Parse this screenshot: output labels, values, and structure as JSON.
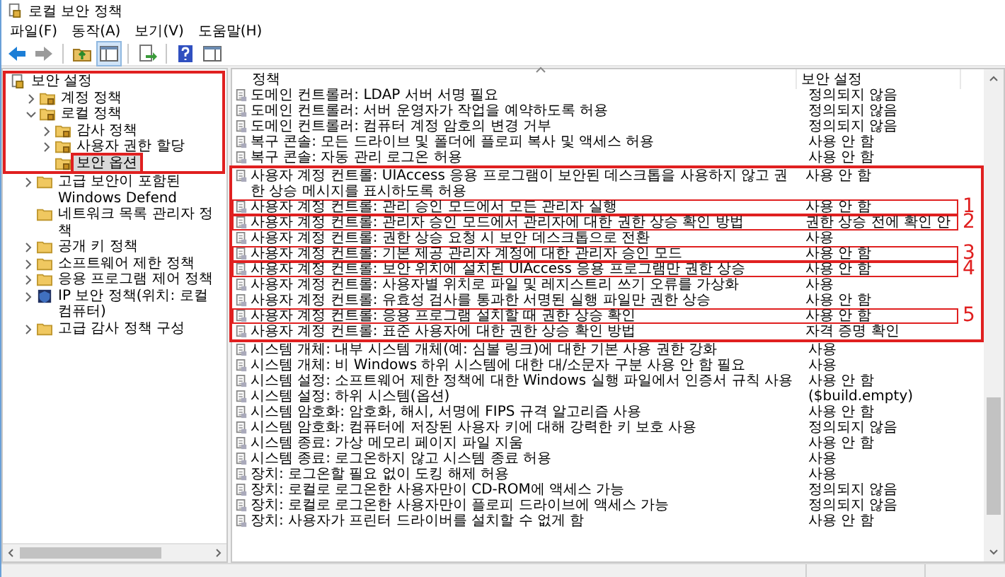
{
  "window": {
    "title": "로컬 보안 정책"
  },
  "menu": [
    "파일(F)",
    "동작(A)",
    "보기(V)",
    "도움말(H)"
  ],
  "toolbar": [
    {
      "kind": "back",
      "disabled": false
    },
    {
      "kind": "forward",
      "disabled": true
    },
    {
      "kind": "sep"
    },
    {
      "kind": "up"
    },
    {
      "kind": "tree",
      "selected": true
    },
    {
      "kind": "sep"
    },
    {
      "kind": "export"
    },
    {
      "kind": "sep"
    },
    {
      "kind": "help"
    },
    {
      "kind": "panel"
    }
  ],
  "tree": [
    {
      "label": "보안 설정",
      "kind": "root",
      "selected": false,
      "boxed": true,
      "children": [
        {
          "label": "계정 정책",
          "kind": "locked-folder",
          "expanded": false,
          "selected": false,
          "boxed": true
        },
        {
          "label": "로컬 정책",
          "kind": "locked-folder",
          "expanded": true,
          "selected": false,
          "boxed": true,
          "children": [
            {
              "label": "감사 정책",
              "kind": "locked-folder",
              "expanded": false,
              "selected": false,
              "boxed": true
            },
            {
              "label": "사용자 권한 할당",
              "kind": "locked-folder",
              "expanded": false,
              "selected": false,
              "boxed": true
            },
            {
              "label": "보안 옵션",
              "kind": "locked-folder",
              "selected": true,
              "boxed": true
            }
          ]
        },
        {
          "label": "고급 보안이 포함된 Windows Defend",
          "kind": "folder",
          "expanded": false,
          "selected": false,
          "boxed": false
        },
        {
          "label": "네트워크 목록 관리자 정책",
          "kind": "folder",
          "selected": false,
          "boxed": false
        },
        {
          "label": "공개 키 정책",
          "kind": "folder",
          "expanded": false,
          "selected": false,
          "boxed": false
        },
        {
          "label": "소프트웨어 제한 정책",
          "kind": "folder",
          "expanded": false,
          "selected": false,
          "boxed": false
        },
        {
          "label": "응용 프로그램 제어 정책",
          "kind": "folder",
          "expanded": false,
          "selected": false,
          "boxed": false
        },
        {
          "label": "IP 보안 정책(위치: 로컬 컴퓨터)",
          "kind": "ip",
          "expanded": false,
          "selected": false,
          "boxed": false
        },
        {
          "label": "고급 감사 정책 구성",
          "kind": "folder",
          "expanded": false,
          "selected": false,
          "boxed": false
        }
      ]
    }
  ],
  "table": {
    "columns": [
      "정책",
      "보안 설정"
    ],
    "rows": [
      {
        "policy": "도메인 컨트롤러: LDAP 서버 서명 필요",
        "setting": "정의되지 않음",
        "outlined": false,
        "in_callout": false
      },
      {
        "policy": "도메인 컨트롤러: 서버 운영자가 작업을 예약하도록 허용",
        "setting": "정의되지 않음",
        "outlined": false,
        "in_callout": false
      },
      {
        "policy": "도메인 컨트롤러: 컴퓨터 계정 암호의 변경 거부",
        "setting": "정의되지 않음",
        "outlined": false,
        "in_callout": false
      },
      {
        "policy": "복구 콘솔: 모든 드라이브 및 폴더에 플로피 복사 및 액세스 허용",
        "setting": "사용 안 함",
        "outlined": false,
        "in_callout": false
      },
      {
        "policy": "복구 콘솔: 자동 관리 로그온 허용",
        "setting": "사용 안 함",
        "outlined": false,
        "in_callout": false
      },
      {
        "policy": "사용자 계정 컨트롤: UIAccess 응용 프로그램이 보안된 데스크톱을 사용하지 않고 권한 상승 메시지를 표시하도록 허용",
        "setting": "사용 안 함",
        "outlined": false,
        "in_callout": true
      },
      {
        "policy": "사용자 계정 컨트롤: 관리 승인 모드에서 모든 관리자 실행",
        "setting": "사용 안 함",
        "outlined": true,
        "in_callout": true,
        "marker": "1"
      },
      {
        "policy": "사용자 계정 컨트롤: 관리자 승인 모드에서 관리자에 대한 권한 상승 확인 방법",
        "setting": "권한 상승 전에 확인 안",
        "outlined": true,
        "in_callout": true,
        "marker": "2"
      },
      {
        "policy": "사용자 계정 컨트롤: 권한 상승 요청 시 보안 데스크톱으로 전환",
        "setting": "사용",
        "outlined": false,
        "in_callout": true
      },
      {
        "policy": "사용자 계정 컨트롤: 기본 제공 관리자 계정에 대한 관리자 승인 모드",
        "setting": "사용 안 함",
        "outlined": true,
        "in_callout": true,
        "marker": "3"
      },
      {
        "policy": "사용자 계정 컨트롤: 보안 위치에 설치된 UIAccess 응용 프로그램만 권한 상승",
        "setting": "사용 안 함",
        "outlined": true,
        "in_callout": true,
        "marker": "4"
      },
      {
        "policy": "사용자 계정 컨트롤: 사용자별 위치로 파일 및 레지스트리 쓰기 오류를 가상화",
        "setting": "사용",
        "outlined": false,
        "in_callout": true
      },
      {
        "policy": "사용자 계정 컨트롤: 유효성 검사를 통과한 서명된 실행 파일만 권한 상승",
        "setting": "사용 안 함",
        "outlined": false,
        "in_callout": true
      },
      {
        "policy": "사용자 계정 컨트롤: 응용 프로그램 설치할 때 권한 상승 확인",
        "setting": "사용 안 함",
        "outlined": true,
        "in_callout": true,
        "marker": "5"
      },
      {
        "policy": "사용자 계정 컨트롤: 표준 사용자에 대한 권한 상승 확인 방법",
        "setting": "자격 증명 확인",
        "outlined": false,
        "in_callout": true
      },
      {
        "policy": "시스템 개체: 내부 시스템 개체(예: 심볼 링크)에 대한 기본 사용 권한 강화",
        "setting": "사용",
        "outlined": false,
        "in_callout": false
      },
      {
        "policy": "시스템 개체: 비 Windows 하위 시스템에 대한 대/소문자 구분 사용 안 함 필요",
        "setting": "사용",
        "outlined": false,
        "in_callout": false
      },
      {
        "policy": "시스템 설정: 소프트웨어 제한 정책에 대한 Windows 실행 파일에서 인증서 규칙 사용",
        "setting": "사용 안 함",
        "outlined": false,
        "in_callout": false
      },
      {
        "policy": "시스템 설정: 하위 시스템(옵션)",
        "setting": "($build.empty)",
        "outlined": false,
        "in_callout": false
      },
      {
        "policy": "시스템 암호화: 암호화, 해시, 서명에 FIPS 규격 알고리즘 사용",
        "setting": "사용 안 함",
        "outlined": false,
        "in_callout": false
      },
      {
        "policy": "시스템 암호화: 컴퓨터에 저장된 사용자 키에 대해 강력한 키 보호 사용",
        "setting": "정의되지 않음",
        "outlined": false,
        "in_callout": false
      },
      {
        "policy": "시스템 종료: 가상 메모리 페이지 파일 지움",
        "setting": "사용 안 함",
        "outlined": false,
        "in_callout": false
      },
      {
        "policy": "시스템 종료: 로그온하지 않고 시스템 종료 허용",
        "setting": "사용",
        "outlined": false,
        "in_callout": false
      },
      {
        "policy": "장치: 로그온할 필요 없이 도킹 해제 허용",
        "setting": "사용",
        "outlined": false,
        "in_callout": false
      },
      {
        "policy": "장치: 로컬로 로그온한 사용자만이 CD-ROM에 액세스 가능",
        "setting": "정의되지 않음",
        "outlined": false,
        "in_callout": false
      },
      {
        "policy": "장치: 로컬로 로그온한 사용자만이 플로피 드라이브에 액세스 가능",
        "setting": "정의되지 않음",
        "outlined": false,
        "in_callout": false
      },
      {
        "policy": "장치: 사용자가 프린터 드라이버를 설치할 수 없게 함",
        "setting": "사용 안 함",
        "outlined": false,
        "in_callout": false
      }
    ]
  }
}
